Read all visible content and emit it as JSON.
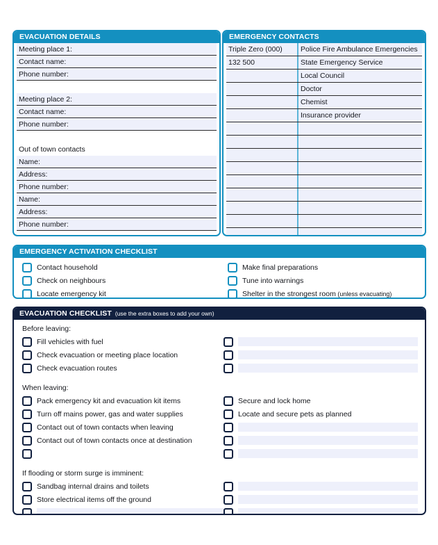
{
  "evacuation_details": {
    "header": "EVACUATION DETAILS",
    "rows": [
      {
        "label": "Meeting place 1:",
        "type": "field"
      },
      {
        "label": "Contact name:",
        "type": "field"
      },
      {
        "label": "Phone number:",
        "type": "field"
      },
      {
        "label": "",
        "type": "spacer"
      },
      {
        "label": "Meeting place 2:",
        "type": "field"
      },
      {
        "label": "Contact name:",
        "type": "field"
      },
      {
        "label": "Phone number:",
        "type": "field"
      },
      {
        "label": "",
        "type": "spacer"
      },
      {
        "label": "Out of town contacts",
        "type": "heading"
      },
      {
        "label": "Name:",
        "type": "field"
      },
      {
        "label": "Address:",
        "type": "field"
      },
      {
        "label": "Phone number:",
        "type": "field"
      },
      {
        "label": "Name:",
        "type": "field"
      },
      {
        "label": "Address:",
        "type": "field"
      },
      {
        "label": "Phone number:",
        "type": "field"
      }
    ]
  },
  "emergency_contacts": {
    "header": "EMERGENCY CONTACTS",
    "rows": [
      {
        "number": "Triple Zero (000)",
        "name": "Police Fire Ambulance Emergencies"
      },
      {
        "number": "132 500",
        "name": "State Emergency Service"
      },
      {
        "number": "",
        "name": "Local Council"
      },
      {
        "number": "",
        "name": "Doctor"
      },
      {
        "number": "",
        "name": "Chemist"
      },
      {
        "number": "",
        "name": "Insurance provider"
      },
      {
        "number": "",
        "name": ""
      },
      {
        "number": "",
        "name": ""
      },
      {
        "number": "",
        "name": ""
      },
      {
        "number": "",
        "name": ""
      },
      {
        "number": "",
        "name": ""
      },
      {
        "number": "",
        "name": ""
      },
      {
        "number": "",
        "name": ""
      },
      {
        "number": "",
        "name": ""
      },
      {
        "number": "",
        "name": ""
      }
    ]
  },
  "activation_checklist": {
    "header": "EMERGENCY ACTIVATION CHECKLIST",
    "left_items": [
      {
        "label": "Contact household",
        "note": ""
      },
      {
        "label": "Check on neighbours",
        "note": ""
      },
      {
        "label": "Locate emergency kit",
        "note": ""
      }
    ],
    "right_items": [
      {
        "label": "Make final preparations",
        "note": ""
      },
      {
        "label": "Tune into warnings",
        "note": ""
      },
      {
        "label": "Shelter in the strongest room",
        "note": "(unless evacuating)"
      }
    ]
  },
  "evacuation_checklist": {
    "header": "EVACUATION CHECKLIST",
    "header_note": "(use the extra boxes to add your own)",
    "groups": [
      {
        "title": "Before leaving:",
        "left_items": [
          {
            "label": "Fill vehicles with fuel",
            "blank": false
          },
          {
            "label": "Check evacuation or meeting place location",
            "blank": false
          },
          {
            "label": "Check evacuation routes",
            "blank": false
          }
        ],
        "right_items": [
          {
            "label": "",
            "blank": true
          },
          {
            "label": "",
            "blank": true
          },
          {
            "label": "",
            "blank": true
          }
        ]
      },
      {
        "title": "When leaving:",
        "left_items": [
          {
            "label": "Pack emergency kit and evacuation kit items",
            "blank": false
          },
          {
            "label": "Turn off mains power, gas and water supplies",
            "blank": false
          },
          {
            "label": "Contact out of town contacts when leaving",
            "blank": false
          },
          {
            "label": "Contact out of town contacts once at destination",
            "blank": false
          },
          {
            "label": "",
            "blank": true,
            "no_fill": true
          }
        ],
        "right_items": [
          {
            "label": "Secure and lock home",
            "blank": false
          },
          {
            "label": "Locate and secure pets as planned",
            "blank": false
          },
          {
            "label": "",
            "blank": true
          },
          {
            "label": "",
            "blank": true
          },
          {
            "label": "",
            "blank": true
          }
        ]
      },
      {
        "title": "If flooding or storm surge is imminent:",
        "left_items": [
          {
            "label": "Sandbag internal drains and toilets",
            "blank": false
          },
          {
            "label": "Store electrical items off the ground",
            "blank": false
          },
          {
            "label": "",
            "blank": true
          }
        ],
        "right_items": [
          {
            "label": "",
            "blank": true
          },
          {
            "label": "",
            "blank": true
          },
          {
            "label": "",
            "blank": true
          }
        ]
      }
    ]
  },
  "colors": {
    "teal": "#1490c0",
    "navy": "#11203f",
    "field_fill": "#eef0fb",
    "rule": "#2b2b2b"
  }
}
